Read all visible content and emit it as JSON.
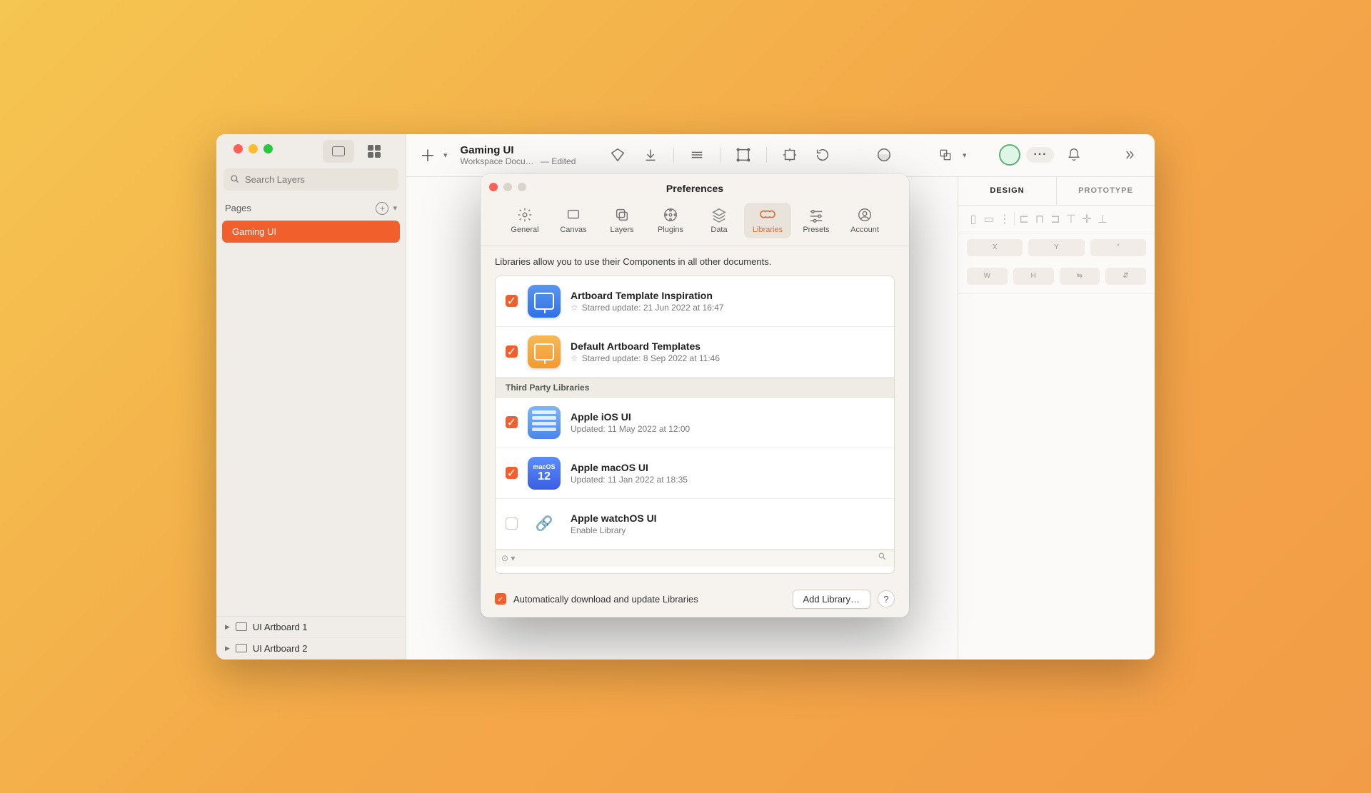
{
  "app": {
    "title": "Gaming UI",
    "subtitle_doc": "Workspace Docu…",
    "subtitle_edited": "—  Edited",
    "search_placeholder": "Search Layers"
  },
  "sidebar": {
    "pages_label": "Pages",
    "active_page": "Gaming UI",
    "layers": [
      {
        "label": "UI Artboard 1"
      },
      {
        "label": "UI Artboard 2"
      }
    ]
  },
  "inspector": {
    "tabs": {
      "design": "DESIGN",
      "prototype": "PROTOTYPE"
    },
    "fields": {
      "x": "X",
      "y": "Y",
      "deg": "°",
      "w": "W",
      "h": "H"
    }
  },
  "prefs": {
    "title": "Preferences",
    "tabs": {
      "general": "General",
      "canvas": "Canvas",
      "layers": "Layers",
      "plugins": "Plugins",
      "data": "Data",
      "libraries": "Libraries",
      "presets": "Presets",
      "account": "Account"
    },
    "intro": "Libraries allow you to use their Components in all other documents.",
    "third_party_header": "Third Party Libraries",
    "auto_label": "Automatically download and update Libraries",
    "add_library": "Add Library…",
    "help": "?",
    "libs": [
      {
        "name": "Artboard Template Inspiration",
        "sub": "Starred update: 21 Jun 2022 at 16:47",
        "starred": true,
        "checked": true,
        "color1": "#2f72e8",
        "color2": "#5a95f1"
      },
      {
        "name": "Default Artboard Templates",
        "sub": "Starred update: 8 Sep 2022 at 11:46",
        "starred": true,
        "checked": true,
        "color1": "#f29a2e",
        "color2": "#f6b857"
      }
    ],
    "third": [
      {
        "name": "Apple iOS UI",
        "sub": "Updated: 11 May 2022 at 12:00",
        "checked": true,
        "kind": "ios"
      },
      {
        "name": "Apple macOS UI",
        "sub": "Updated: 11 Jan 2022 at 18:35",
        "checked": true,
        "kind": "mac",
        "mac_label": "macOS",
        "mac_num": "12"
      },
      {
        "name": "Apple watchOS UI",
        "sub": "Enable Library",
        "checked": false,
        "kind": "watch"
      }
    ]
  }
}
